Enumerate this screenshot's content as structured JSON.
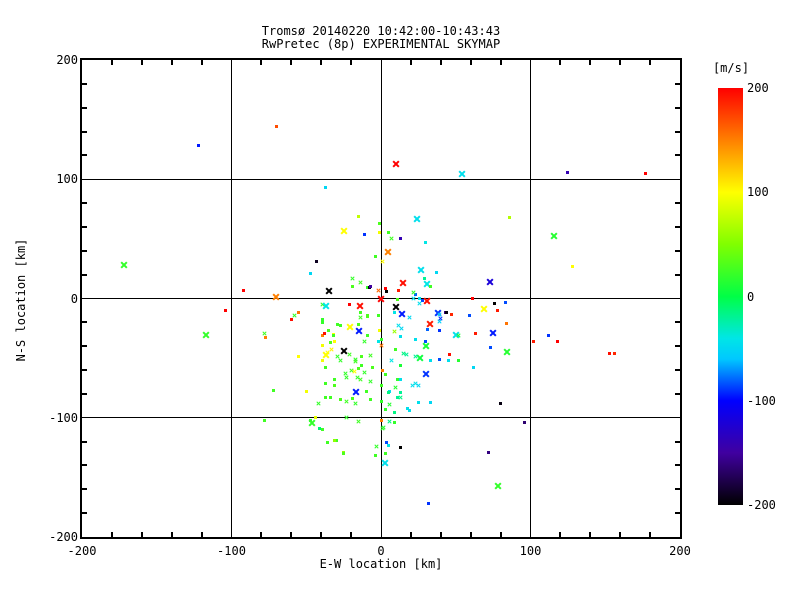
{
  "title": {
    "line1": "Tromsø 20140220 10:42:00-10:43:43",
    "line2": "RwPretec (8p) EXPERIMENTAL SKYMAP"
  },
  "chart_data": {
    "type": "scatter",
    "title_line1": "Tromsø 20140220 10:42:00-10:43:43",
    "title_line2": "RwPretec (8p) EXPERIMENTAL SKYMAP",
    "xlabel": "E-W location [km]",
    "ylabel": "N-S location [km]",
    "xlim": [
      -200,
      200
    ],
    "ylim": [
      -200,
      200
    ],
    "xticks": [
      -200,
      -100,
      0,
      100,
      200
    ],
    "yticks": [
      -200,
      -100,
      0,
      100,
      200
    ],
    "minor_tick_step": 20,
    "grid": "full-length black gridlines at -100, 0, +100 on both axes",
    "background": "#ffffff",
    "colorbar": {
      "label": "[m/s]",
      "ticks": [
        200,
        100,
        0,
        -100,
        -200
      ],
      "vmin": -200,
      "vmax": 200,
      "position": "right"
    },
    "cmap_stops": [
      [
        200,
        "#ff0000"
      ],
      [
        150,
        "#ff8000"
      ],
      [
        100,
        "#ffff00"
      ],
      [
        50,
        "#80ff00"
      ],
      [
        0,
        "#00ff46"
      ],
      [
        -40,
        "#00e6e6"
      ],
      [
        -60,
        "#00c8ff"
      ],
      [
        -100,
        "#0000ff"
      ],
      [
        -150,
        "#4000a0"
      ],
      [
        -200,
        "#000000"
      ]
    ],
    "point_format": "[x_km, y_km, velocity_m_s_from_color, marker] marker: X=large cross, x=small cross, .=dot",
    "points": [
      [
        -70,
        144,
        170,
        "."
      ],
      [
        -122,
        128,
        -95,
        "."
      ],
      [
        10,
        113,
        200,
        "X"
      ],
      [
        54,
        104,
        -45,
        "X"
      ],
      [
        125,
        106,
        -140,
        "."
      ],
      [
        177,
        105,
        200,
        "."
      ],
      [
        -37,
        93,
        -50,
        "."
      ],
      [
        -15,
        69,
        75,
        "."
      ],
      [
        -25,
        57,
        100,
        "X"
      ],
      [
        -1,
        63,
        30,
        "."
      ],
      [
        -11,
        54,
        -90,
        "."
      ],
      [
        5,
        55,
        25,
        "."
      ],
      [
        24,
        67,
        -45,
        "X"
      ],
      [
        7,
        50,
        25,
        "x"
      ],
      [
        13,
        50,
        -140,
        "."
      ],
      [
        30,
        47,
        -40,
        "."
      ],
      [
        116,
        52,
        15,
        "X"
      ],
      [
        86,
        68,
        70,
        "."
      ],
      [
        -172,
        28,
        20,
        "X"
      ],
      [
        -43,
        31,
        -190,
        "."
      ],
      [
        -47,
        21,
        -50,
        "."
      ],
      [
        5,
        39,
        150,
        "X"
      ],
      [
        1,
        31,
        100,
        "x"
      ],
      [
        128,
        27,
        100,
        "."
      ],
      [
        27,
        24,
        -45,
        "X"
      ],
      [
        37,
        22,
        -50,
        "."
      ],
      [
        29,
        17,
        -20,
        "."
      ],
      [
        31,
        12,
        -40,
        "X"
      ],
      [
        15,
        13,
        195,
        "X"
      ],
      [
        73,
        14,
        -120,
        "X"
      ],
      [
        3,
        8,
        200,
        "."
      ],
      [
        4,
        6,
        -200,
        "."
      ],
      [
        12,
        7,
        190,
        "."
      ],
      [
        23,
        3,
        -80,
        "."
      ],
      [
        22,
        0,
        -45,
        "x"
      ],
      [
        61,
        0,
        200,
        "."
      ],
      [
        -92,
        7,
        200,
        "."
      ],
      [
        -19,
        17,
        20,
        "x"
      ],
      [
        -14,
        13,
        25,
        "x"
      ],
      [
        -9,
        9,
        20,
        "."
      ],
      [
        -4,
        35,
        25,
        "."
      ],
      [
        -35,
        6,
        -200,
        "X"
      ],
      [
        -2,
        7,
        160,
        "x"
      ],
      [
        -70,
        1,
        150,
        "X"
      ],
      [
        -8,
        9,
        -195,
        "."
      ],
      [
        -19,
        10,
        30,
        "."
      ],
      [
        -7,
        10,
        -150,
        "."
      ],
      [
        22,
        5,
        20,
        "x"
      ],
      [
        33,
        10,
        25,
        "."
      ],
      [
        -1,
        55,
        95,
        "."
      ],
      [
        0,
        0,
        200,
        "X"
      ],
      [
        11,
        -1,
        30,
        "."
      ],
      [
        26,
        0,
        -45,
        "."
      ],
      [
        28,
        -2,
        -85,
        "."
      ],
      [
        31,
        -2,
        195,
        "X"
      ],
      [
        -39,
        -5,
        20,
        "x"
      ],
      [
        -37,
        -6,
        -40,
        "X"
      ],
      [
        -21,
        -5,
        200,
        "."
      ],
      [
        -14,
        -6,
        195,
        "X"
      ],
      [
        10,
        -7,
        -200,
        "X"
      ],
      [
        14,
        -13,
        -95,
        "X"
      ],
      [
        19,
        -16,
        -50,
        "x"
      ],
      [
        38,
        -12,
        -90,
        "X"
      ],
      [
        39,
        -19,
        -55,
        "x"
      ],
      [
        43,
        -12,
        -160,
        "."
      ],
      [
        47,
        -13,
        185,
        "."
      ],
      [
        -14,
        -12,
        25,
        "."
      ],
      [
        -9,
        -14,
        30,
        "."
      ],
      [
        -39,
        -18,
        20,
        "."
      ],
      [
        -27,
        -23,
        25,
        "."
      ],
      [
        -21,
        -24,
        100,
        "X"
      ],
      [
        -15,
        -27,
        -95,
        "X"
      ],
      [
        12,
        -23,
        -45,
        "x"
      ],
      [
        14,
        -25,
        -50,
        "x"
      ],
      [
        33,
        -21,
        190,
        "X"
      ],
      [
        13,
        -32,
        -45,
        "."
      ],
      [
        -39,
        -31,
        150,
        "."
      ],
      [
        -32,
        -30,
        100,
        "."
      ],
      [
        -35,
        -27,
        30,
        "."
      ],
      [
        -9,
        -31,
        25,
        "."
      ],
      [
        0,
        -34,
        20,
        "."
      ],
      [
        31,
        -26,
        -80,
        "."
      ],
      [
        39,
        -27,
        -90,
        "."
      ],
      [
        50,
        -31,
        -45,
        "X"
      ],
      [
        30,
        -40,
        10,
        "X"
      ],
      [
        -25,
        -44,
        -200,
        "X"
      ],
      [
        -37,
        -47,
        100,
        "X"
      ],
      [
        -33,
        -43,
        105,
        "x"
      ],
      [
        0,
        -39,
        155,
        "x"
      ],
      [
        10,
        -43,
        25,
        "."
      ],
      [
        15,
        -46,
        -15,
        "x"
      ],
      [
        17,
        -47,
        -20,
        "x"
      ],
      [
        26,
        -50,
        5,
        "X"
      ],
      [
        46,
        -47,
        195,
        "."
      ],
      [
        -39,
        -52,
        95,
        "."
      ],
      [
        -29,
        -49,
        20,
        "x"
      ],
      [
        -21,
        -47,
        25,
        "x"
      ],
      [
        -17,
        -51,
        20,
        "x"
      ],
      [
        -13,
        -49,
        30,
        "."
      ],
      [
        -7,
        -48,
        25,
        "x"
      ],
      [
        7,
        -52,
        -40,
        "x"
      ],
      [
        13,
        -56,
        10,
        "."
      ],
      [
        23,
        -49,
        -20,
        "x"
      ],
      [
        33,
        -52,
        -45,
        "."
      ],
      [
        39,
        -51,
        -85,
        "."
      ],
      [
        52,
        -52,
        15,
        "."
      ],
      [
        -37,
        -58,
        25,
        "."
      ],
      [
        -24,
        -63,
        20,
        "x"
      ],
      [
        -20,
        -60,
        25,
        "x"
      ],
      [
        -15,
        -59,
        30,
        "."
      ],
      [
        -11,
        -62,
        20,
        "x"
      ],
      [
        1,
        -60,
        150,
        "."
      ],
      [
        3,
        -64,
        25,
        "."
      ],
      [
        30,
        -63,
        -90,
        "X"
      ],
      [
        13,
        -68,
        -45,
        "."
      ],
      [
        -37,
        -71,
        25,
        "."
      ],
      [
        -31,
        -73,
        30,
        "."
      ],
      [
        -23,
        -66,
        20,
        "x"
      ],
      [
        -14,
        -68,
        25,
        "x"
      ],
      [
        -7,
        -70,
        20,
        "x"
      ],
      [
        0,
        -73,
        25,
        "."
      ],
      [
        10,
        -75,
        15,
        "x"
      ],
      [
        23,
        -71,
        -45,
        "x"
      ],
      [
        25,
        -73,
        -50,
        "x"
      ],
      [
        -17,
        -78,
        -95,
        "X"
      ],
      [
        -10,
        -78,
        25,
        "."
      ],
      [
        6,
        -78,
        -45,
        "."
      ],
      [
        13,
        -79,
        -20,
        "."
      ],
      [
        -37,
        -83,
        25,
        "."
      ],
      [
        -27,
        -85,
        30,
        "."
      ],
      [
        -17,
        -88,
        20,
        "x"
      ],
      [
        -7,
        -85,
        25,
        "."
      ],
      [
        0,
        -86,
        20,
        "."
      ],
      [
        6,
        -89,
        15,
        "x"
      ],
      [
        13,
        -83,
        -15,
        "x"
      ],
      [
        25,
        -87,
        -45,
        "."
      ],
      [
        33,
        -87,
        -50,
        "."
      ],
      [
        3,
        -93,
        20,
        "."
      ],
      [
        9,
        -96,
        -15,
        "."
      ],
      [
        19,
        -94,
        -45,
        "."
      ],
      [
        -23,
        -100,
        20,
        "x"
      ],
      [
        -15,
        -103,
        25,
        "x"
      ],
      [
        0,
        -102,
        150,
        "."
      ],
      [
        6,
        -103,
        -15,
        "x"
      ],
      [
        -104,
        -10,
        200,
        "."
      ],
      [
        -117,
        -31,
        20,
        "X"
      ],
      [
        -78,
        -29,
        25,
        "x"
      ],
      [
        -77,
        -33,
        150,
        "."
      ],
      [
        -58,
        -14,
        20,
        "x"
      ],
      [
        -55,
        -12,
        155,
        "."
      ],
      [
        -60,
        -18,
        195,
        "."
      ],
      [
        -55,
        -49,
        100,
        "."
      ],
      [
        -72,
        -77,
        25,
        "."
      ],
      [
        -50,
        -78,
        95,
        "."
      ],
      [
        -47,
        -102,
        20,
        "."
      ],
      [
        -44,
        -100,
        90,
        "."
      ],
      [
        -42,
        -88,
        20,
        "x"
      ],
      [
        -78,
        -102,
        25,
        "."
      ],
      [
        -46,
        -104,
        20,
        "X"
      ],
      [
        -14,
        -16,
        25,
        "x"
      ],
      [
        -9,
        -15,
        30,
        "."
      ],
      [
        -2,
        -14,
        25,
        "."
      ],
      [
        -39,
        -20,
        20,
        "."
      ],
      [
        -29,
        -22,
        25,
        "."
      ],
      [
        -15,
        -22,
        30,
        "."
      ],
      [
        -1,
        -27,
        95,
        "."
      ],
      [
        -38,
        -29,
        195,
        "."
      ],
      [
        -32,
        -31,
        25,
        "."
      ],
      [
        -31,
        -36,
        100,
        "."
      ],
      [
        -11,
        -36,
        20,
        "x"
      ],
      [
        -2,
        -36,
        -40,
        "."
      ],
      [
        -39,
        -39,
        95,
        "."
      ],
      [
        -34,
        -37,
        30,
        "."
      ],
      [
        -36,
        -45,
        100,
        "x"
      ],
      [
        -27,
        -52,
        20,
        "x"
      ],
      [
        -17,
        -53,
        25,
        "x"
      ],
      [
        -18,
        -61,
        100,
        "x"
      ],
      [
        -13,
        -56,
        25,
        "."
      ],
      [
        -6,
        -58,
        30,
        "."
      ],
      [
        -31,
        -68,
        25,
        "."
      ],
      [
        -16,
        -66,
        20,
        "x"
      ],
      [
        -23,
        -86,
        25,
        "x"
      ],
      [
        -19,
        -84,
        30,
        "."
      ],
      [
        -34,
        -83,
        25,
        "."
      ],
      [
        -3,
        -124,
        20,
        "x"
      ],
      [
        -4,
        -132,
        25,
        "."
      ],
      [
        -30,
        -119,
        25,
        "."
      ],
      [
        -25,
        -129,
        60,
        "."
      ],
      [
        -25,
        -130,
        30,
        "."
      ],
      [
        -36,
        -121,
        25,
        "."
      ],
      [
        -31,
        -119,
        55,
        "."
      ],
      [
        -41,
        -109,
        -10,
        "."
      ],
      [
        -39,
        -110,
        25,
        "."
      ],
      [
        2,
        -108,
        15,
        "x"
      ],
      [
        9,
        -104,
        20,
        "."
      ],
      [
        4,
        -121,
        -85,
        "."
      ],
      [
        13,
        -125,
        -200,
        "."
      ],
      [
        3,
        -130,
        25,
        "."
      ],
      [
        3,
        -138,
        -45,
        "X"
      ],
      [
        72,
        -129,
        -160,
        "."
      ],
      [
        78,
        -157,
        20,
        "X"
      ],
      [
        32,
        -172,
        -90,
        "."
      ],
      [
        26,
        -4,
        -45,
        "x"
      ],
      [
        9,
        -12,
        -40,
        "."
      ],
      [
        39,
        -13,
        -50,
        "x"
      ],
      [
        40,
        -17,
        -90,
        "x"
      ],
      [
        44,
        -12,
        -195,
        "."
      ],
      [
        59,
        -14,
        -85,
        "."
      ],
      [
        69,
        -9,
        100,
        "X"
      ],
      [
        78,
        -10,
        190,
        "."
      ],
      [
        76,
        -4,
        -200,
        "."
      ],
      [
        83,
        -3,
        -85,
        "."
      ],
      [
        84,
        -21,
        155,
        "."
      ],
      [
        52,
        -31,
        10,
        "x"
      ],
      [
        63,
        -29,
        190,
        "."
      ],
      [
        75,
        -29,
        -95,
        "X"
      ],
      [
        73,
        -41,
        -85,
        "."
      ],
      [
        9,
        -28,
        60,
        "x"
      ],
      [
        23,
        -34,
        -45,
        "."
      ],
      [
        30,
        -36,
        -85,
        "."
      ],
      [
        84,
        -45,
        15,
        "X"
      ],
      [
        45,
        -52,
        -45,
        "."
      ],
      [
        62,
        -58,
        -50,
        "."
      ],
      [
        11,
        -68,
        20,
        "."
      ],
      [
        21,
        -73,
        -45,
        "x"
      ],
      [
        5,
        -79,
        -15,
        "."
      ],
      [
        11,
        -83,
        -20,
        "."
      ],
      [
        18,
        -92,
        -45,
        "."
      ],
      [
        80,
        -88,
        -195,
        "."
      ],
      [
        102,
        -36,
        190,
        "."
      ],
      [
        118,
        -36,
        200,
        "."
      ],
      [
        112,
        -31,
        -90,
        "."
      ],
      [
        153,
        -46,
        195,
        "."
      ],
      [
        156,
        -46,
        185,
        "."
      ],
      [
        1,
        -109,
        20,
        "x"
      ],
      [
        96,
        -104,
        -165,
        "."
      ],
      [
        5,
        -123,
        -40,
        "."
      ]
    ]
  }
}
